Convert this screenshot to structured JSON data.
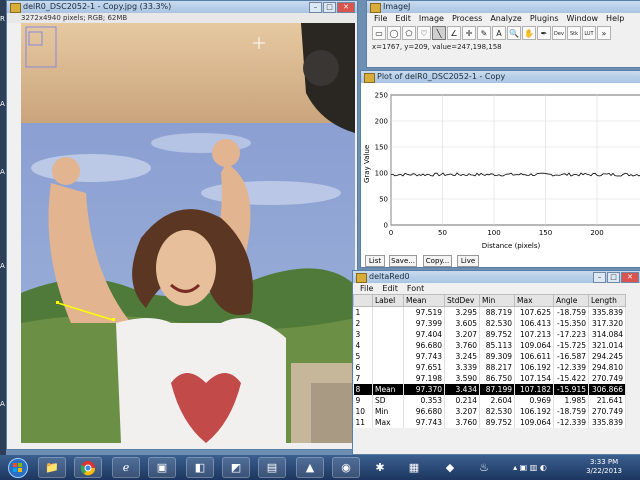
{
  "image_window": {
    "title": "delR0_DSC2052-1 - Copy.jpg (33.3%)",
    "info": "3272x4940 pixels; RGB; 62MB"
  },
  "imagej": {
    "title": "ImageJ",
    "menu": [
      "File",
      "Edit",
      "Image",
      "Process",
      "Analyze",
      "Plugins",
      "Window",
      "Help"
    ],
    "status": "x=1767, y=209, value=247,198,158",
    "tools": [
      "rect-tool",
      "oval-tool",
      "poly-tool",
      "free-tool",
      "line-tool",
      "angle-tool",
      "point-tool",
      "wand-tool",
      "text-tool",
      "zoom-tool",
      "hand-tool",
      "dropper-tool",
      "dev-tool",
      "stk-tool",
      "lut-tool",
      "more-tool"
    ],
    "tool_glyphs": [
      "▭",
      "◯",
      "⬠",
      "♡",
      "╲",
      "∠",
      "✛",
      "✎",
      "A",
      "🔍",
      "✋",
      "✒",
      "Dev",
      "Stk",
      "LUT",
      "»"
    ]
  },
  "plot": {
    "title": "Plot of delR0_DSC2052-1 - Copy",
    "ylabel": "Gray Value",
    "xlabel": "Distance (pixels)",
    "yticks": [
      "0",
      "50",
      "100",
      "150",
      "200",
      "250"
    ],
    "xticks": [
      "0",
      "50",
      "100",
      "150",
      "200"
    ],
    "buttons": [
      "List",
      "Save...",
      "Copy...",
      "Live"
    ]
  },
  "results": {
    "title": "deltaRed0",
    "menu": [
      "File",
      "Edit",
      "Font"
    ],
    "headers": [
      "",
      "Label",
      "Mean",
      "StdDev",
      "Min",
      "Max",
      "Angle",
      "Length"
    ],
    "rows": [
      [
        "1",
        "",
        "97.519",
        "3.295",
        "88.719",
        "107.625",
        "-18.759",
        "335.839"
      ],
      [
        "2",
        "",
        "97.399",
        "3.605",
        "82.530",
        "106.413",
        "-15.350",
        "317.320"
      ],
      [
        "3",
        "",
        "97.404",
        "3.207",
        "89.752",
        "107.213",
        "-17.223",
        "314.084"
      ],
      [
        "4",
        "",
        "96.680",
        "3.760",
        "85.113",
        "109.064",
        "-15.725",
        "321.014"
      ],
      [
        "5",
        "",
        "97.743",
        "3.245",
        "89.309",
        "106.611",
        "-16.587",
        "294.245"
      ],
      [
        "6",
        "",
        "97.651",
        "3.339",
        "88.217",
        "106.192",
        "-12.339",
        "294.810"
      ],
      [
        "7",
        "",
        "97.198",
        "3.590",
        "86.750",
        "107.154",
        "-15.422",
        "270.749"
      ],
      [
        "8",
        "Mean",
        "97.370",
        "3.434",
        "87.199",
        "107.182",
        "-15.915",
        "306.866"
      ],
      [
        "9",
        "SD",
        "0.353",
        "0.214",
        "2.604",
        "0.969",
        "1.985",
        "21.641"
      ],
      [
        "10",
        "Min",
        "96.680",
        "3.207",
        "82.530",
        "106.192",
        "-18.759",
        "270.749"
      ],
      [
        "11",
        "Max",
        "97.743",
        "3.760",
        "89.752",
        "109.064",
        "-12.339",
        "335.839"
      ]
    ]
  },
  "taskbar": {
    "time": "3:33 PM",
    "date": "3/22/2013"
  },
  "desktop_labels": [
    "R",
    "A",
    "A",
    "A",
    "A"
  ]
}
